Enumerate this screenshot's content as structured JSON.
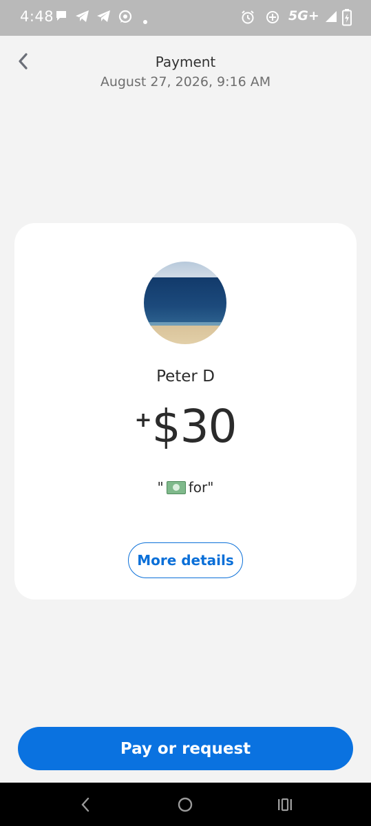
{
  "status_bar": {
    "time": "4:48",
    "network": "5G+",
    "left_icons": [
      "chat-bubble-icon",
      "telegram-icon",
      "telegram-icon",
      "whatsapp-icon",
      "dot-icon"
    ],
    "right_icons": [
      "alarm-icon",
      "data-saver-icon",
      "signal-icon",
      "battery-icon"
    ]
  },
  "header": {
    "title": "Payment",
    "subtitle": "August 27, 2026, 9:16 AM"
  },
  "card": {
    "name": "Peter D",
    "amount_sign": "+",
    "amount": "$30",
    "note_open_quote": "\"",
    "note_text": "for\"",
    "more_details_label": "More details"
  },
  "cta": {
    "label": "Pay or request"
  },
  "colors": {
    "accent": "#0a72e0",
    "background": "#f3f3f3",
    "card": "#ffffff",
    "status_bar": "#b9b9b9"
  }
}
